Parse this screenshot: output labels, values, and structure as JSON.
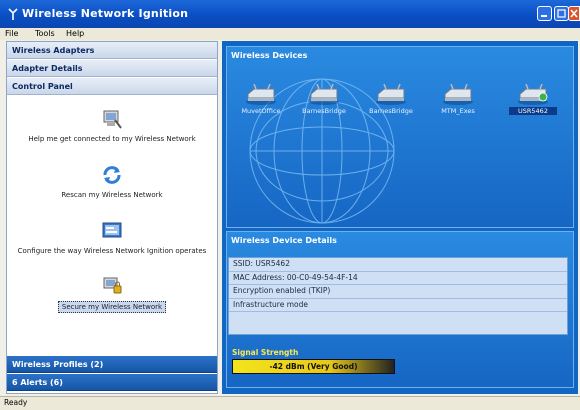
{
  "window": {
    "title": "Wireless Network Ignition"
  },
  "menu": {
    "file": "File",
    "tools": "Tools",
    "help": "Help"
  },
  "sidebar": {
    "adapters": "Wireless Adapters",
    "adapter_details": "Adapter Details",
    "control_panel": "Control Panel",
    "profiles": "Wireless Profiles (2)",
    "alerts": "6 Alerts (6)"
  },
  "control_panel": {
    "items": [
      {
        "label": "Help me get connected to my Wireless Network",
        "icon": "computer-help-icon"
      },
      {
        "label": "Rescan my Wireless Network",
        "icon": "rescan-icon"
      },
      {
        "label": "Configure the way Wireless Network Ignition operates",
        "icon": "configure-icon"
      },
      {
        "label": "Secure my Wireless Network",
        "icon": "secure-icon"
      }
    ]
  },
  "devices_panel": {
    "title": "Wireless Devices",
    "devices": [
      {
        "label": "MuvetOffice",
        "selected": false
      },
      {
        "label": "BarnesBridge",
        "selected": false
      },
      {
        "label": "BarnesBridge",
        "selected": false
      },
      {
        "label": "MTM_Exes",
        "selected": false
      },
      {
        "label": "USR5462",
        "selected": true
      }
    ]
  },
  "details_panel": {
    "title": "Wireless Device Details",
    "rows": [
      "SSID: USR5462",
      "MAC Address: 00-C0-49-54-4F-14",
      "Encryption enabled (TKIP)",
      "Infrastructure mode"
    ],
    "signal_label": "Signal Strength",
    "signal_value": "-42 dBm (Very Good)"
  },
  "status": {
    "text": "Ready"
  }
}
